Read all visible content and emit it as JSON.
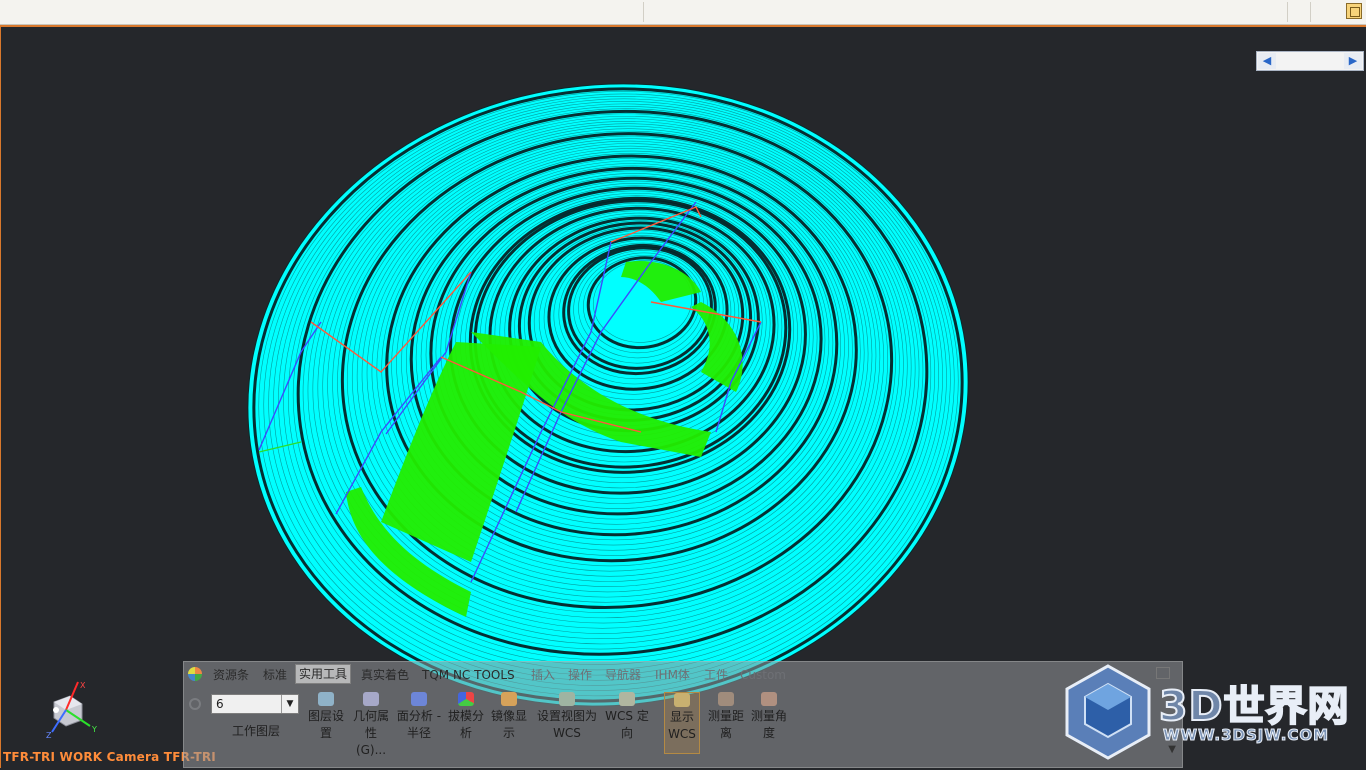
{
  "colors": {
    "viewport_bg": "#25272b",
    "model_cyan": "#00ffff",
    "model_green": "#22ee00",
    "status_orange": "#ff8c3a",
    "viewport_border": "#d9782c"
  },
  "ribbon": {
    "tabs": [
      {
        "label": "资源条",
        "state": "normal"
      },
      {
        "label": "标准",
        "state": "normal"
      },
      {
        "label": "实用工具",
        "state": "active"
      },
      {
        "label": "真实着色",
        "state": "normal"
      },
      {
        "label": "TQM NC TOOLS",
        "state": "normal"
      },
      {
        "label": "插入",
        "state": "faded"
      },
      {
        "label": "操作",
        "state": "faded"
      },
      {
        "label": "导航器",
        "state": "faded"
      },
      {
        "label": "IHM体",
        "state": "faded"
      },
      {
        "label": "工件",
        "state": "faded"
      },
      {
        "label": "Custom",
        "state": "faded"
      }
    ],
    "layer_value": "6",
    "layer_label": "工作图层",
    "tools": [
      {
        "line1": "图层设",
        "line2": "置",
        "icon": "layer-settings-icon"
      },
      {
        "line1": "几何属",
        "line2": "性(G)...",
        "icon": "geometry-properties-icon"
      },
      {
        "line1": "面分析 -",
        "line2": "半径",
        "icon": "face-analysis-icon"
      },
      {
        "line1": "拔模分",
        "line2": "析",
        "icon": "draft-analysis-icon"
      },
      {
        "line1": "镜像显",
        "line2": "示",
        "icon": "mirror-display-icon"
      },
      {
        "line1": "设置视图为",
        "line2": "WCS",
        "icon": "set-view-wcs-icon"
      },
      {
        "line1": "WCS 定",
        "line2": "向",
        "icon": "wcs-orient-icon"
      },
      {
        "line1": "显示",
        "line2": "WCS",
        "icon": "display-wcs-icon"
      },
      {
        "line1": "测量距",
        "line2": "离",
        "icon": "measure-distance-icon"
      },
      {
        "line1": "测量角",
        "line2": "度",
        "icon": "measure-angle-icon"
      }
    ]
  },
  "status_text": "TFR-TRI WORK Camera TFR-TRI",
  "triad_labels": {
    "x": "X",
    "y": "Y",
    "z": "Z"
  },
  "watermark": {
    "title": "3D世界网",
    "url": "WWW.3DSJW.COM"
  }
}
